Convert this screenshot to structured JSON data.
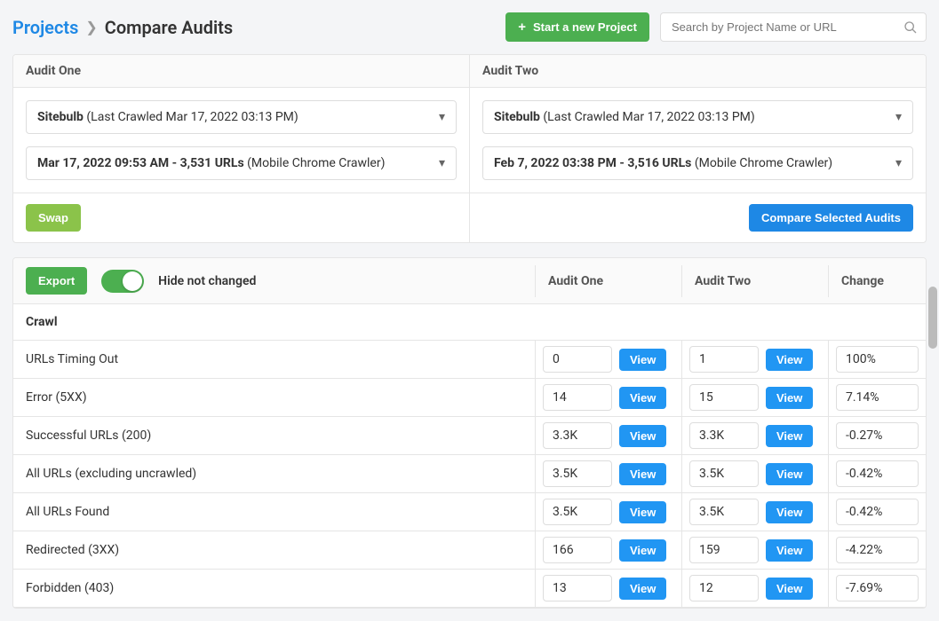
{
  "breadcrumb": {
    "root": "Projects",
    "current": "Compare Audits"
  },
  "header": {
    "start_project": "Start a new Project",
    "search_placeholder": "Search by Project Name or URL"
  },
  "audit_one": {
    "title": "Audit One",
    "project_name": "Sitebulb",
    "project_meta": " (Last Crawled Mar 17, 2022 03:13 PM)",
    "audit_main": "Mar 17, 2022 09:53 AM - 3,531 URLs",
    "audit_meta": " (Mobile Chrome Crawler)"
  },
  "audit_two": {
    "title": "Audit Two",
    "project_name": "Sitebulb",
    "project_meta": " (Last Crawled Mar 17, 2022 03:13 PM)",
    "audit_main": "Feb 7, 2022 03:38 PM - 3,516 URLs",
    "audit_meta": " (Mobile Chrome Crawler)"
  },
  "buttons": {
    "swap": "Swap",
    "compare": "Compare Selected Audits",
    "export": "Export",
    "view": "View"
  },
  "toggle_label": "Hide not changed",
  "columns": {
    "a1": "Audit One",
    "a2": "Audit Two",
    "chg": "Change"
  },
  "section": "Crawl",
  "rows": [
    {
      "name": "URLs Timing Out",
      "a1": "0",
      "a2": "1",
      "chg": "100%"
    },
    {
      "name": "Error (5XX)",
      "a1": "14",
      "a2": "15",
      "chg": "7.14%"
    },
    {
      "name": "Successful URLs (200)",
      "a1": "3.3K",
      "a2": "3.3K",
      "chg": "-0.27%"
    },
    {
      "name": "All URLs (excluding uncrawled)",
      "a1": "3.5K",
      "a2": "3.5K",
      "chg": "-0.42%"
    },
    {
      "name": "All URLs Found",
      "a1": "3.5K",
      "a2": "3.5K",
      "chg": "-0.42%"
    },
    {
      "name": "Redirected (3XX)",
      "a1": "166",
      "a2": "159",
      "chg": "-4.22%"
    },
    {
      "name": "Forbidden (403)",
      "a1": "13",
      "a2": "12",
      "chg": "-7.69%"
    }
  ]
}
